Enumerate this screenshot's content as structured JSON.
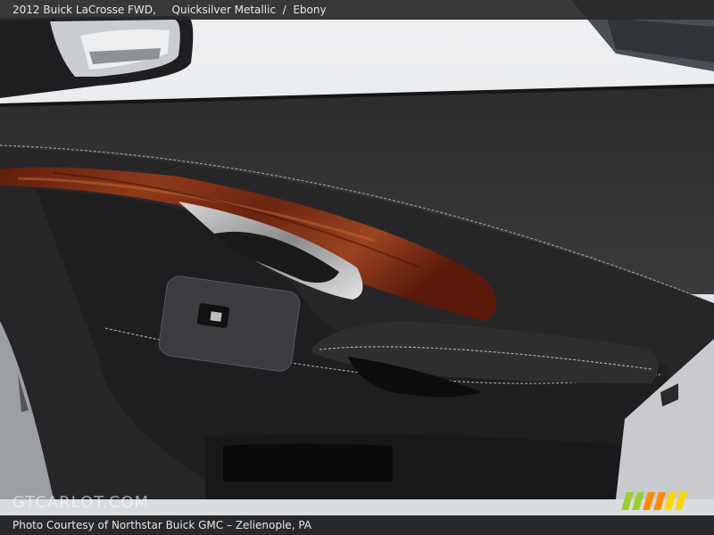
{
  "header": {
    "vehicle": "2012 Buick LaCrosse FWD",
    "exterior": "Quicksilver Metallic",
    "interior": "Ebony"
  },
  "footer": {
    "credit": "Photo Courtesy of Northstar Buick GMC – Zelienople, PA"
  },
  "watermark": "GTCARLOT.COM",
  "logo_colors": [
    "#9acd32",
    "#ff8c00",
    "#ffd700"
  ]
}
